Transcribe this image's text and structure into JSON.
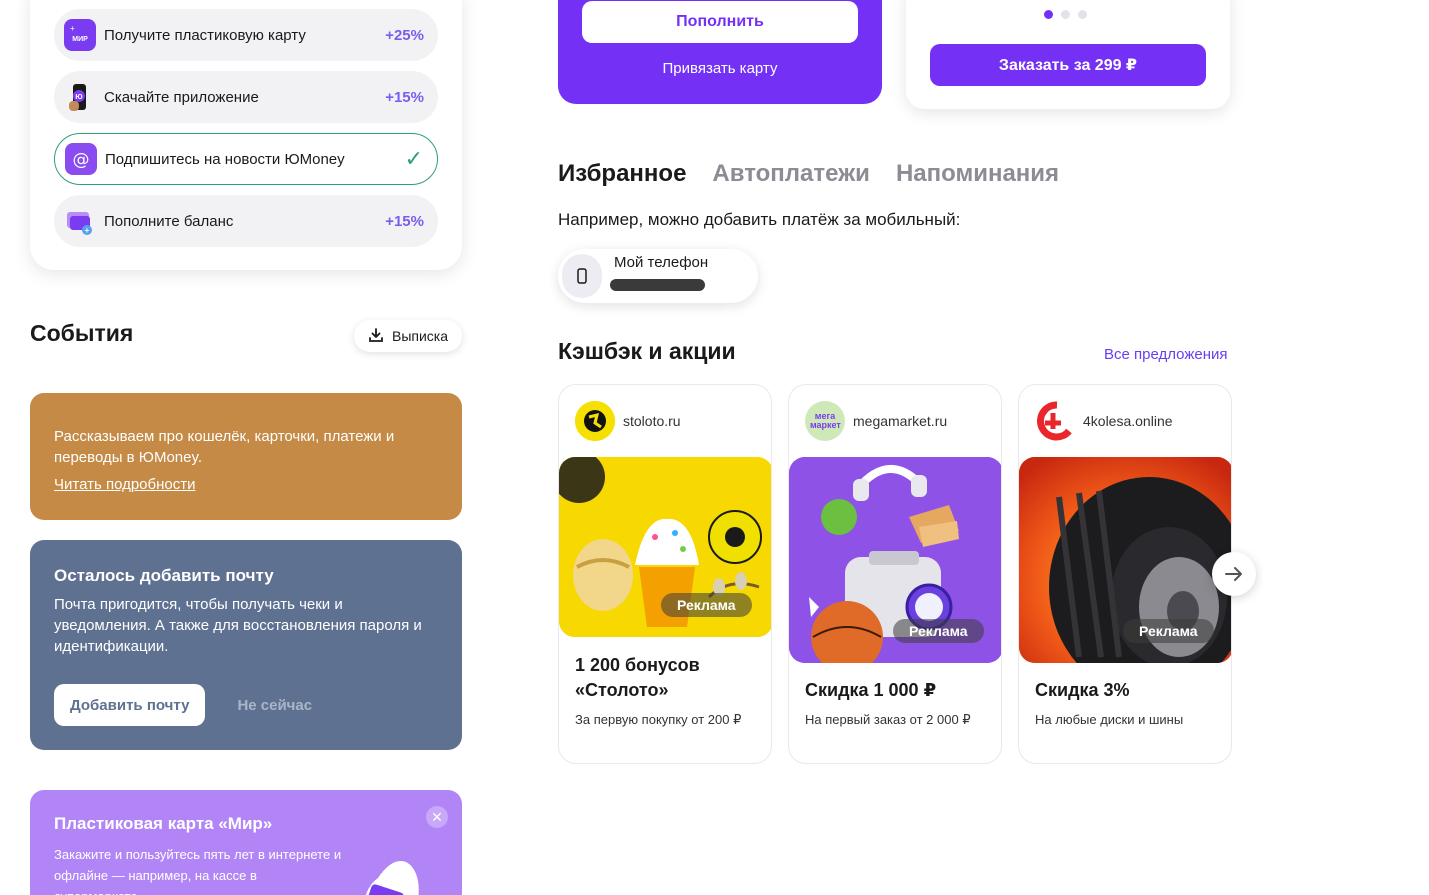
{
  "tasks": [
    {
      "label": "Получите пластиковую карту",
      "bonus": "+25%",
      "icon": "mir-card-icon",
      "done": false
    },
    {
      "label": "Скачайте приложение",
      "bonus": "+15%",
      "icon": "phone-app-icon",
      "done": false
    },
    {
      "label": "Подпишитесь на новости ЮMoney",
      "bonus": "",
      "icon": "at-sign-icon",
      "done": true
    },
    {
      "label": "Пополните баланс",
      "bonus": "+15%",
      "icon": "wallet-topup-icon",
      "done": false
    }
  ],
  "mir_mini_label": "МИР",
  "events": {
    "title": "События",
    "statement_label": "Выписка"
  },
  "promo_blog": {
    "text": "Рассказываем про кошелёк, карточки, платежи и переводы в ЮMoney.",
    "link": "Читать подробности"
  },
  "promo_email": {
    "title": "Осталось добавить почту",
    "text": "Почта пригодится, чтобы получать чеки и уведомления. А также для восстановления пароля и идентификации.",
    "add_label": "Добавить почту",
    "later_label": "Не сейчас"
  },
  "promo_card": {
    "title": "Пластиковая карта «Мир»",
    "text": "Закажите и пользуйтесь пять лет в интернете и офлайне — например, на кассе в супермаркете"
  },
  "wallet_card": {
    "topup_label": "Пополнить",
    "bind_label": "Привязать карту"
  },
  "order_card": {
    "order_label": "Заказать за 299 ₽",
    "active_slide": 1,
    "slides": 3
  },
  "tabs": [
    "Избранное",
    "Автоплатежи",
    "Напоминания"
  ],
  "favorites": {
    "hint": "Например, можно добавить платёж за мобильный:",
    "chip_name": "Мой телефон"
  },
  "cashback": {
    "title": "Кэшбэк и акции",
    "all_label": "Все предложения",
    "ad_label": "Реклама",
    "offers": [
      {
        "domain": "stoloto.ru",
        "title": "1 200 бонусов «Столото»",
        "subtitle": "За первую покупку от 200 ₽",
        "logo_color": "#f5e000"
      },
      {
        "domain": "megamarket.ru",
        "title": "Скидка 1 000 ₽",
        "subtitle": "На первый заказ от 2 000 ₽",
        "logo_color": "#cfe8b8",
        "logo_text": "мега маркет"
      },
      {
        "domain": "4kolesa.online",
        "title": "Скидка 3%",
        "subtitle": "На любые диски и шины",
        "logo_color": "#e8262c"
      }
    ]
  },
  "colors": {
    "accent": "#7431f5",
    "success": "#2e9e7a",
    "promo_blog_bg": "#c48a46",
    "promo_email_bg": "#5e7190",
    "promo_card_bg": "#b285f7"
  }
}
